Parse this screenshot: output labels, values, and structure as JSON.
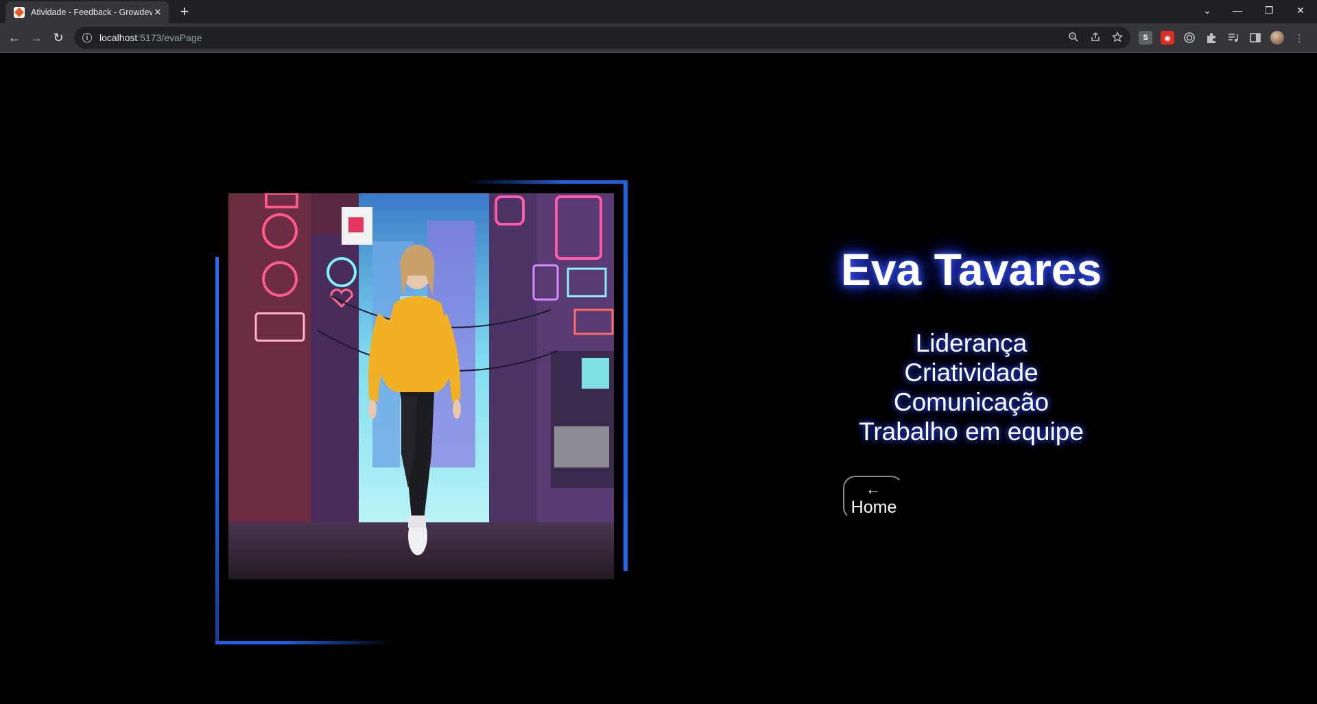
{
  "browser": {
    "tab_title": "Atividade - Feedback - Growdev",
    "tab_close": "✕",
    "new_tab": "+",
    "url_host": "localhost",
    "url_path": ":5173/evaPage",
    "window_controls": {
      "tabs_menu": "⌄",
      "minimize": "—",
      "restore": "❐",
      "close": "✕"
    },
    "nav": {
      "back": "←",
      "forward": "→",
      "reload": "↻"
    },
    "omnibox_icons": [
      "zoom-icon",
      "share-icon",
      "star-icon"
    ],
    "extension_icons": [
      "skype-extension-icon",
      "red-extension-icon",
      "target-extension-icon",
      "puzzle-icon",
      "media-icon",
      "side-panel-icon",
      "profile-avatar",
      "menu-icon"
    ]
  },
  "page": {
    "name": "Eva Tavares",
    "skills": [
      "Liderança",
      "Criatividade",
      "Comunicação",
      "Trabalho em equipe"
    ],
    "home_button": {
      "arrow": "←",
      "label": "Home"
    },
    "accent_color": "#1c5fe0",
    "background_color": "#000000"
  }
}
